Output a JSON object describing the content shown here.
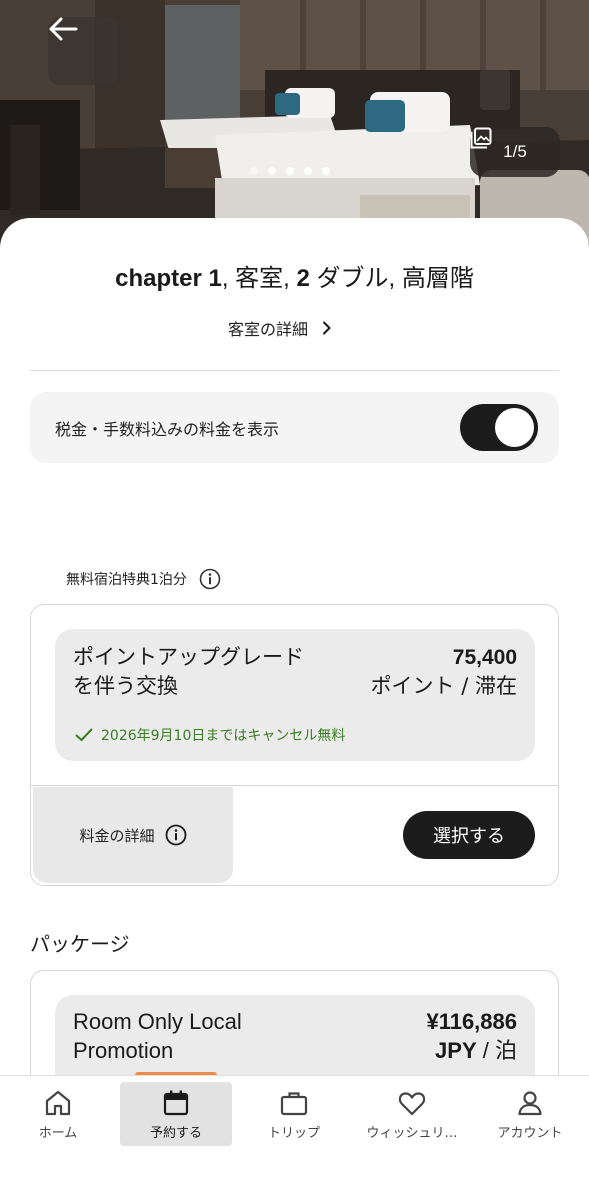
{
  "hero": {
    "photo_counter": "1/5",
    "total_dots": 5,
    "active_dot": 2
  },
  "room": {
    "title_prefix": "chapter ",
    "title_1": "1",
    "title_mid": ", 客室, ",
    "title_2": "2",
    "title_rest": " ダブル, 高層階",
    "details_link": "客室の詳細"
  },
  "tax_toggle": {
    "label": "税金・手数料込みの料金を表示",
    "on": true
  },
  "free_night": {
    "label": "無料宿泊特典1泊分"
  },
  "offers": [
    {
      "name": "ポイントアップグレードを伴う交換",
      "price": "75,400",
      "unit_a": "ポイント",
      "unit_sep": " / ",
      "unit_b": "滞在",
      "cancel_note": "2026年9月10日まではキャンセル無料",
      "rate_details": "料金の詳細",
      "select_label": "選択する"
    },
    {
      "name": "Room Only Local Promotion",
      "price": "¥116,886",
      "unit_a": "JPY",
      "unit_sep": " / ",
      "unit_b": "泊"
    }
  ],
  "package_section": {
    "label": "パッケージ"
  },
  "bottom_nav": {
    "items": [
      {
        "label": "ホーム",
        "icon": "home-icon"
      },
      {
        "label": "予約する",
        "icon": "calendar-icon",
        "active": true
      },
      {
        "label": "トリップ",
        "icon": "briefcase-icon"
      },
      {
        "label": "ウィッシュリ…",
        "icon": "heart-icon"
      },
      {
        "label": "アカウント",
        "icon": "user-icon"
      }
    ]
  },
  "colors": {
    "accent_dark": "#1c1c1c",
    "cancel_green": "#3b7d23",
    "nav_indicator": "#f08a4b"
  }
}
